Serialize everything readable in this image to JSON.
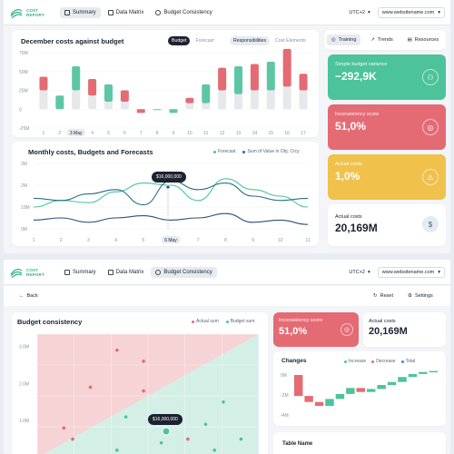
{
  "app": {
    "logo_line1": "COST",
    "logo_line2": "REPORT"
  },
  "nav": {
    "summary": "Summary",
    "data_matrix": "Data Matrix",
    "budget_consistency": "Budget Consistency",
    "timezone": "UTC+2",
    "url": "www.websitename.com"
  },
  "december": {
    "title": "December costs against budget",
    "toggle_budget": "Budget",
    "toggle_forecast": "Forecast",
    "toggle_responsibilities": "Responsibilities",
    "toggle_cost_elements": "Cost Elements",
    "yticks": [
      "75M",
      "50M",
      "25M",
      "0",
      "-25M"
    ],
    "xticks": [
      "1",
      "2",
      "3 May",
      "4",
      "5",
      "6",
      "7",
      "8",
      "9",
      "10",
      "11",
      "12",
      "13",
      "14",
      "15",
      "16",
      "17"
    ],
    "chart_data": {
      "type": "bar",
      "categories": [
        "1",
        "2",
        "3 May",
        "4",
        "5",
        "6",
        "7",
        "8",
        "9",
        "10",
        "11",
        "12",
        "13",
        "14",
        "15",
        "16",
        "17"
      ],
      "ylim": [
        -25,
        75
      ],
      "series": [
        {
          "values": [
            43,
            18,
            57,
            40,
            33,
            25,
            -5,
            0,
            -5,
            15,
            33,
            55,
            57,
            60,
            63,
            80,
            47
          ],
          "colors": [
            "#e46b74",
            "#5ec6a5",
            "#5ec6a5",
            "#e46b74",
            "#5ec6a5",
            "#e46b74",
            "#e46b74",
            "#5ec6a5",
            "#5ec6a5",
            "#e46b74",
            "#5ec6a5",
            "#e46b74",
            "#5ec6a5",
            "#e46b74",
            "#5ec6a5",
            "#e46b74",
            "#e46b74"
          ]
        },
        {
          "values": [
            25,
            18,
            25,
            18,
            10,
            10,
            0,
            0,
            0,
            8,
            8,
            25,
            20,
            25,
            25,
            30,
            25
          ]
        }
      ]
    }
  },
  "side": {
    "training": "Training",
    "trends": "Trends",
    "resources": "Resources"
  },
  "kpis": [
    {
      "label": "Simple budget variance",
      "value": "−292,9K",
      "color": "#4cc39b"
    },
    {
      "label": "Inconsistency score",
      "value": "51,0%",
      "color": "#e46b74"
    },
    {
      "label": "Actual costs",
      "value": "1,0%",
      "color": "#f0c14b"
    }
  ],
  "actual": {
    "label": "Actual costs",
    "value": "20,169M"
  },
  "monthly": {
    "title": "Monthly costs, Budgets and Forecasts",
    "legend_forecast": "Forecast",
    "legend_sum": "Sum of Value in Obj. Crcy",
    "yticks": [
      "3M",
      "2M",
      "10M",
      "0M"
    ],
    "xticks": [
      "1",
      "2",
      "3",
      "4",
      "5",
      "6 May",
      "7",
      "8",
      "9",
      "10",
      "11"
    ],
    "tooltip": "$16,000,000",
    "chart_data": {
      "type": "line",
      "x": [
        "1",
        "2",
        "3",
        "4",
        "5",
        "6 May",
        "7",
        "8",
        "9",
        "10",
        "11"
      ],
      "series": [
        {
          "name": "Forecast",
          "values": [
            1.0,
            1.3,
            1.2,
            1.7,
            2.1,
            2.0,
            1.3,
            2.3,
            1.8,
            1.5,
            1.0
          ]
        },
        {
          "name": "Sum of Value in Obj. Crcy",
          "values": [
            1.4,
            1.3,
            1.6,
            1.8,
            1.1,
            2.2,
            1.8,
            2.1,
            1.5,
            1.3,
            1.4
          ]
        },
        {
          "values": [
            0.4,
            0.5,
            0.3,
            0.5,
            0.6,
            0.4,
            0.5,
            0.7,
            0.3,
            0.4,
            0.2
          ]
        }
      ]
    }
  },
  "consistency": {
    "back": "Back",
    "reset": "Reset",
    "settings": "Settings",
    "title": "Budget consistency",
    "legend_actual": "Actual sum",
    "legend_budget": "Budget sum",
    "yticks": [
      "3.0M",
      "2.0M",
      "1.0M"
    ],
    "tooltip": "$16,000,000",
    "chart_data": {
      "type": "scatter",
      "ylim": [
        0,
        3.0
      ],
      "series": [
        {
          "name": "Actual sum",
          "points": [
            [
              0.9,
              2.9
            ],
            [
              1.2,
              2.6
            ],
            [
              0.6,
              1.9
            ],
            [
              1.2,
              1.8
            ],
            [
              0.3,
              0.8
            ],
            [
              0.4,
              0.5
            ],
            [
              1.7,
              0.5
            ]
          ]
        },
        {
          "name": "Budget sum",
          "points": [
            [
              2.1,
              1.5
            ],
            [
              1.0,
              1.1
            ],
            [
              1.9,
              0.9
            ],
            [
              1.4,
              0.4
            ],
            [
              2.3,
              0.5
            ],
            [
              0.9,
              0.2
            ],
            [
              2.0,
              0.2
            ]
          ]
        }
      ]
    }
  },
  "inconsistency2": {
    "label": "Inconsistency score",
    "value": "51,0%"
  },
  "actual2": {
    "label": "Actual costs",
    "value": "20,169M"
  },
  "changes": {
    "title": "Changes",
    "increase": "Increase",
    "decrease": "Decrease",
    "total": "Total",
    "yticks": [
      "0M",
      "-2M",
      "-4M"
    ],
    "chart_data": {
      "type": "bar",
      "values": [
        -2.1,
        -0.6,
        -0.4,
        0.7,
        0.5,
        0.6,
        -0.4,
        0.3,
        0.4,
        0.3,
        0.5,
        0.3,
        0.2,
        0.1
      ],
      "ylim": [
        -4,
        0
      ]
    }
  },
  "table": {
    "title": "Table Name"
  }
}
